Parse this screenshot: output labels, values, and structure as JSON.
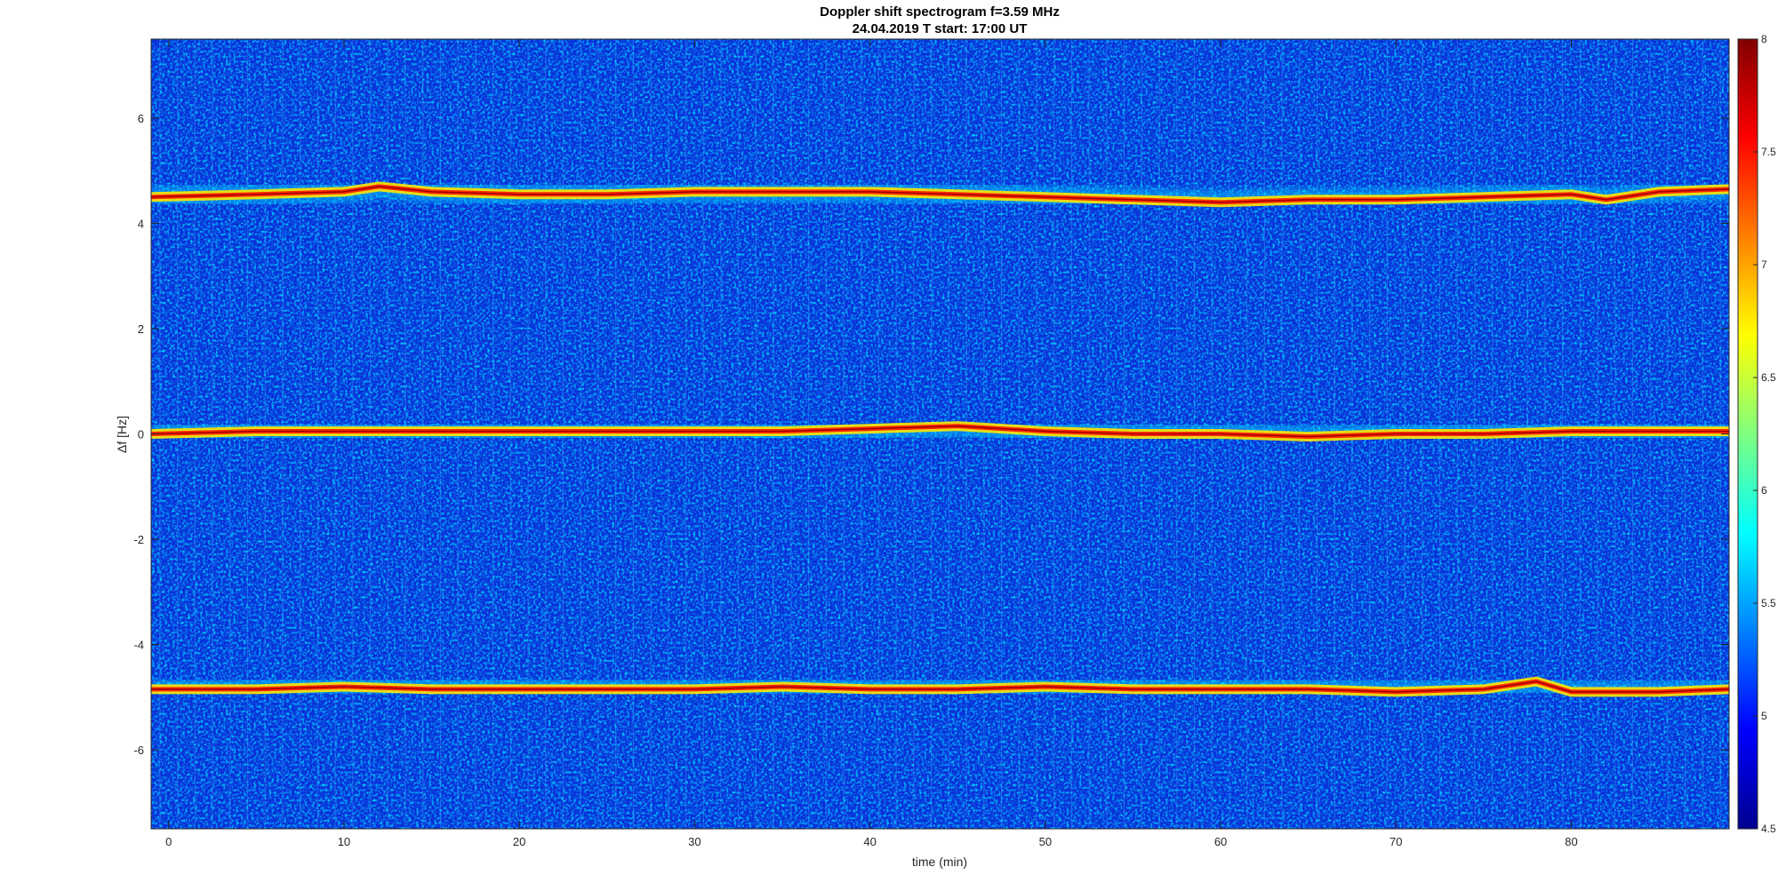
{
  "chart_data": {
    "type": "heatmap",
    "title": "Doppler shift spectrogram f=3.59 MHz",
    "subtitle": "24.04.2019   T start: 17:00 UT",
    "xlabel": "time (min)",
    "ylabel": "Δf [Hz]",
    "xlim": [
      -1,
      89
    ],
    "ylim": [
      -7.5,
      7.5
    ],
    "x_ticks": [
      0,
      10,
      20,
      30,
      40,
      50,
      60,
      70,
      80
    ],
    "y_ticks": [
      -6,
      -4,
      -2,
      0,
      2,
      4,
      6
    ],
    "colormap": "jet",
    "colorbar": {
      "range": [
        4.5,
        8
      ],
      "ticks": [
        4.5,
        5,
        5.5,
        6,
        6.5,
        7,
        7.5,
        8
      ]
    },
    "series": [
      {
        "x": [
          -1,
          5,
          10,
          12,
          15,
          20,
          25,
          30,
          35,
          40,
          45,
          50,
          55,
          60,
          65,
          70,
          75,
          80,
          82,
          85,
          89
        ],
        "y": [
          4.5,
          4.55,
          4.6,
          4.7,
          4.6,
          4.55,
          4.55,
          4.6,
          4.6,
          4.6,
          4.55,
          4.5,
          4.45,
          4.4,
          4.45,
          4.45,
          4.5,
          4.55,
          4.45,
          4.6,
          4.65
        ]
      },
      {
        "x": [
          -1,
          5,
          10,
          15,
          20,
          25,
          30,
          35,
          40,
          45,
          50,
          55,
          60,
          65,
          70,
          75,
          80,
          85,
          89
        ],
        "y": [
          0.0,
          0.05,
          0.05,
          0.05,
          0.05,
          0.05,
          0.05,
          0.05,
          0.1,
          0.15,
          0.05,
          0.0,
          0.0,
          -0.05,
          0.0,
          0.0,
          0.05,
          0.05,
          0.05
        ]
      },
      {
        "x": [
          -1,
          5,
          10,
          15,
          20,
          25,
          30,
          35,
          40,
          45,
          50,
          55,
          60,
          65,
          70,
          75,
          78,
          80,
          85,
          89
        ],
        "y": [
          -4.85,
          -4.85,
          -4.8,
          -4.85,
          -4.85,
          -4.85,
          -4.85,
          -4.8,
          -4.85,
          -4.85,
          -4.8,
          -4.85,
          -4.85,
          -4.85,
          -4.9,
          -4.85,
          -4.7,
          -4.9,
          -4.9,
          -4.85
        ]
      }
    ]
  }
}
